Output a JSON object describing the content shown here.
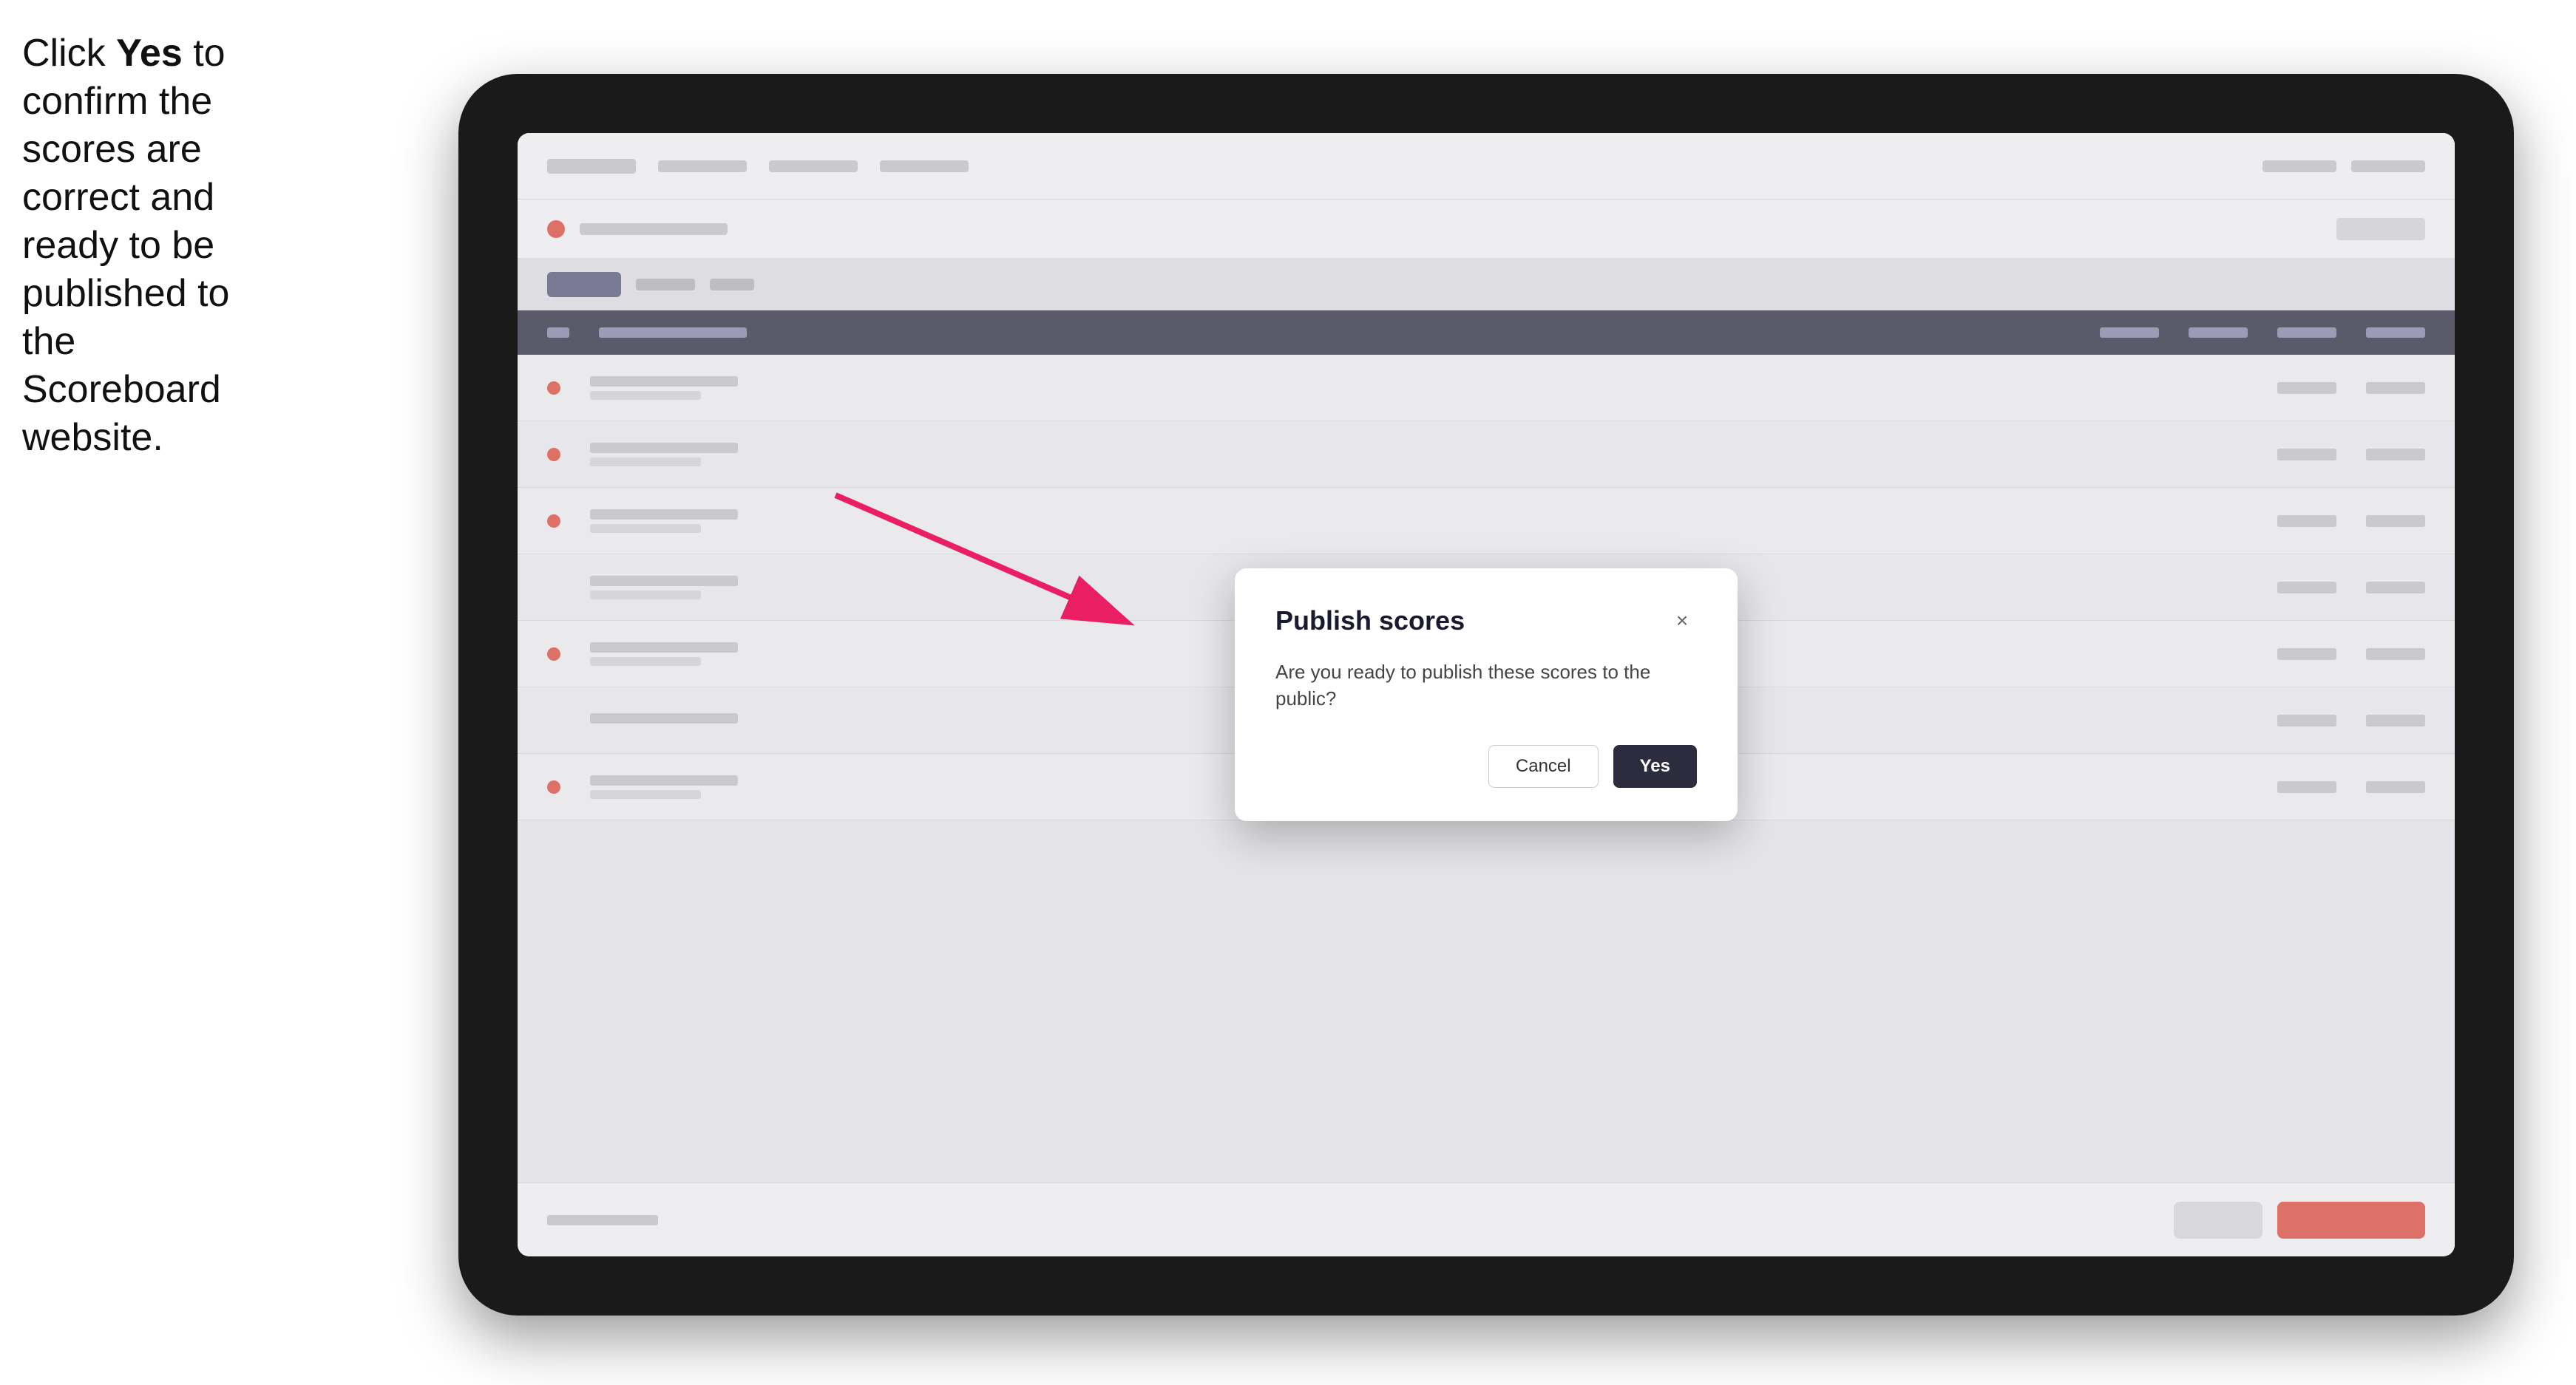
{
  "instruction": {
    "text_before": "Click ",
    "bold_text": "Yes",
    "text_after": " to confirm the scores are correct and ready to be published to the Scoreboard website."
  },
  "modal": {
    "title": "Publish scores",
    "body": "Are you ready to publish these scores to the public?",
    "cancel_label": "Cancel",
    "yes_label": "Yes",
    "close_icon": "×"
  },
  "table": {
    "rows": [
      {
        "has_indicator": true
      },
      {
        "has_indicator": true
      },
      {
        "has_indicator": true
      },
      {
        "has_indicator": false
      },
      {
        "has_indicator": false
      },
      {
        "has_indicator": false
      },
      {
        "has_indicator": false
      }
    ]
  },
  "colors": {
    "yes_button_bg": "#2c2c3e",
    "indicator_color": "#e74c3c",
    "arrow_color": "#e91e63"
  }
}
